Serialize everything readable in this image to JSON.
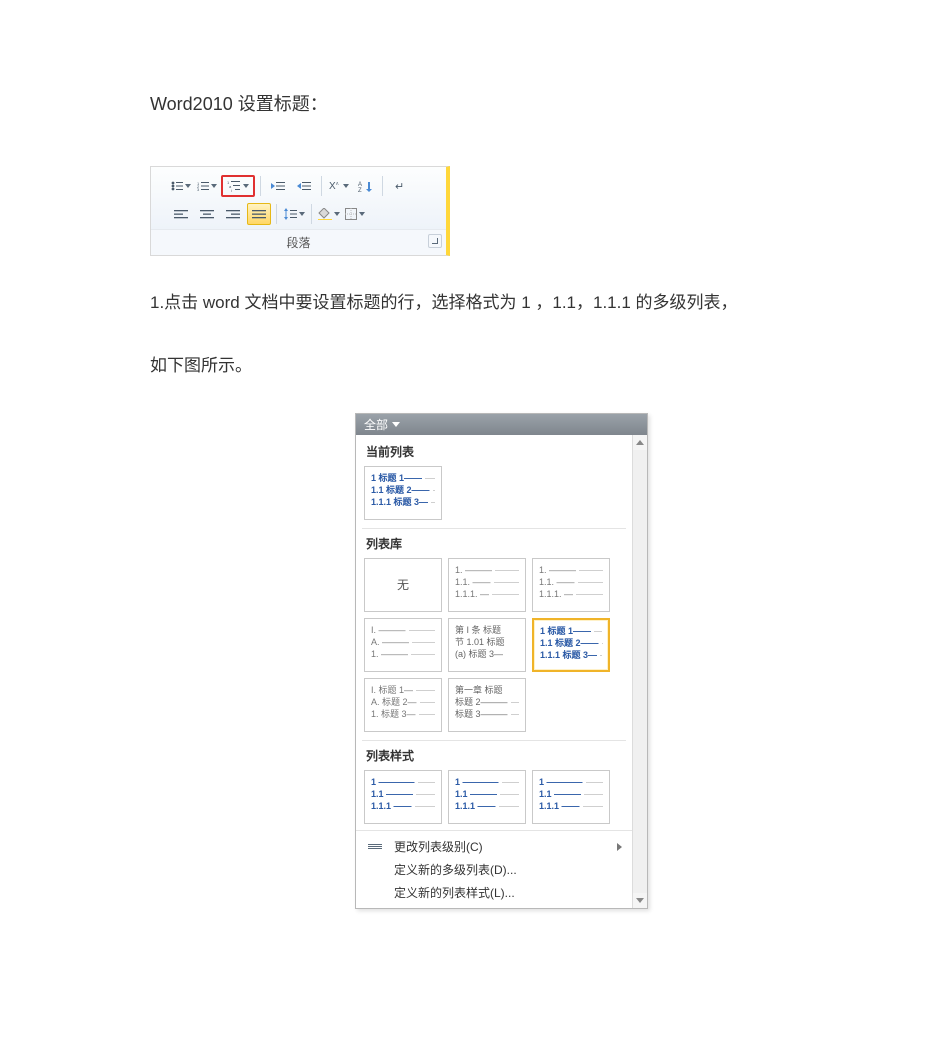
{
  "doc": {
    "title": "Word2010 设置标题：",
    "step1": "1.点击 word 文档中要设置标题的行，选择格式为 1 ，1.1，1.1.1 的多级列表，",
    "step1b": "如下图所示。"
  },
  "ribbon": {
    "group_label": "段落",
    "icons": {
      "bullets": "bullets-icon",
      "numbering": "numbering-icon",
      "multilevel": "multilevel-list-icon",
      "indent_dec": "decrease-indent-icon",
      "indent_inc": "increase-indent-icon",
      "cjk_layout": "asian-layout-icon",
      "sort": "sort-icon",
      "show_marks": "show-hide-icon",
      "align_left": "align-left-icon",
      "align_center": "align-center-icon",
      "align_right": "align-right-icon",
      "align_justify": "align-justify-icon",
      "line_spacing": "line-spacing-icon",
      "shading": "shading-icon",
      "borders": "borders-icon"
    }
  },
  "dropdown": {
    "header": "全部",
    "sections": {
      "current": "当前列表",
      "library": "列表库",
      "styles": "列表样式"
    },
    "none_label": "无",
    "thumbs": {
      "current": [
        "1 标题 1——",
        "1.1 标题 2——",
        "1.1.1 标题 3—"
      ],
      "lib_2": [
        "1. ———",
        "1.1. ——",
        "1.1.1. —"
      ],
      "lib_3": [
        "1. ———",
        "1.1. ——",
        "1.1.1. —"
      ],
      "lib_4": [
        "I. ———",
        "A. ———",
        "1. ———"
      ],
      "lib_5": [
        "第 I 条 标题",
        "节 1.01 标题",
        "(a) 标题 3—"
      ],
      "lib_6": [
        "1 标题 1——",
        "1.1 标题 2——",
        "1.1.1 标题 3—"
      ],
      "lib_7": [
        "I. 标题 1—",
        "A. 标题 2—",
        "1. 标题 3—"
      ],
      "lib_8": [
        "第一章 标题",
        "标题 2———",
        "标题 3———"
      ],
      "style_1": [
        "1 ————",
        "1.1 ———",
        "1.1.1 ——"
      ],
      "style_2": [
        "1 ————",
        "1.1 ———",
        "1.1.1 ——"
      ],
      "style_3": [
        "1 ————",
        "1.1 ———",
        "1.1.1 ——"
      ]
    },
    "footer": {
      "change_level": "更改列表级别(C)",
      "define_new_list": "定义新的多级列表(D)...",
      "define_new_style": "定义新的列表样式(L)..."
    }
  }
}
